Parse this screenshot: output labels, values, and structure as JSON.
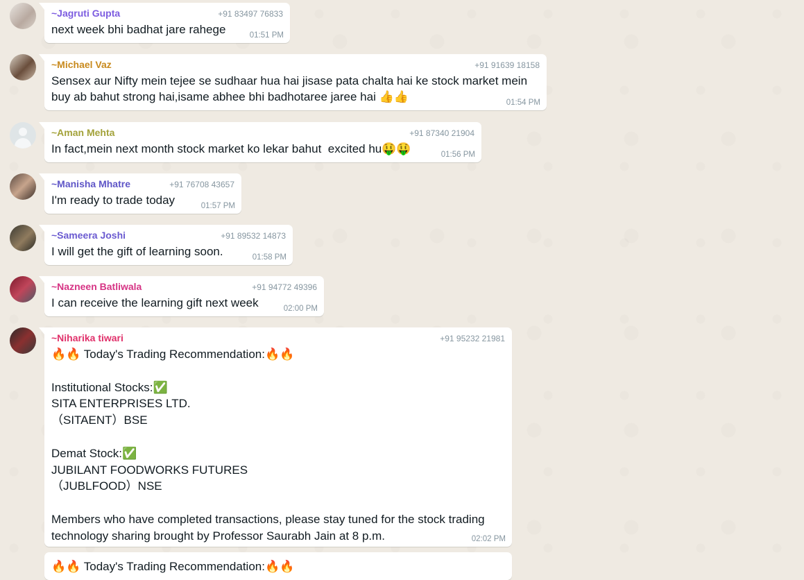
{
  "messages": [
    {
      "name": "~Jagruti Gupta",
      "phone": "+91 83497 76833",
      "text": "next week bhi badhat jare rahege",
      "time": "01:51 PM",
      "color": "#7c5ce0",
      "avatar": "photo-1"
    },
    {
      "name": "~Michael Vaz",
      "phone": "+91 91639 18158",
      "text": "Sensex aur Nifty mein tejee se sudhaar hua hai jisase pata chalta hai ke stock market mein\nbuy ab bahut strong hai,isame abhee bhi badhotaree jaree hai 👍👍",
      "time": "01:54 PM",
      "color": "#c88a1e",
      "avatar": "photo-2"
    },
    {
      "name": "~Aman Mehta",
      "phone": "+91 87340 21904",
      "text": "In fact,mein next month stock market ko lekar bahut  excited hu🤑🤑",
      "time": "01:56 PM",
      "color": "#a3a23a",
      "avatar": "default"
    },
    {
      "name": "~Manisha Mhatre",
      "phone": "+91 76708 43657",
      "text": "I'm ready to trade today",
      "time": "01:57 PM",
      "color": "#5f56c7",
      "avatar": "photo-3"
    },
    {
      "name": "~Sameera Joshi",
      "phone": "+91 89532 14873",
      "text": "I will get the gift of learning soon.",
      "time": "01:58 PM",
      "color": "#6a5ad0",
      "avatar": "photo-4"
    },
    {
      "name": "~Nazneen Batliwala",
      "phone": "+91 94772 49396",
      "text": "I can receive the learning gift next week",
      "time": "02:00 PM",
      "color": "#d63384",
      "avatar": "photo-5"
    },
    {
      "name": "~Niharika tiwari",
      "phone": "+91 95232 21981",
      "text": "🔥🔥 Today's Trading Recommendation:🔥🔥\n\nInstitutional Stocks:✅\nSITA ENTERPRISES LTD.\n（SITAENT）BSE\n\nDemat Stock:✅\nJUBILANT FOODWORKS FUTURES\n（JUBLFOOD）NSE\n\nMembers who have completed transactions, please stay tuned for the stock trading\ntechnology sharing brought by Professor Saurabh Jain at 8 p.m.",
      "time": "02:02 PM",
      "color": "#e0306a",
      "avatar": "photo-6"
    },
    {
      "text": "🔥🔥 Today's Trading Recommendation:🔥🔥"
    }
  ],
  "colors": {
    "chat_bg": "#efeae2",
    "bubble_bg": "#ffffff",
    "meta_text": "#8696a0"
  }
}
